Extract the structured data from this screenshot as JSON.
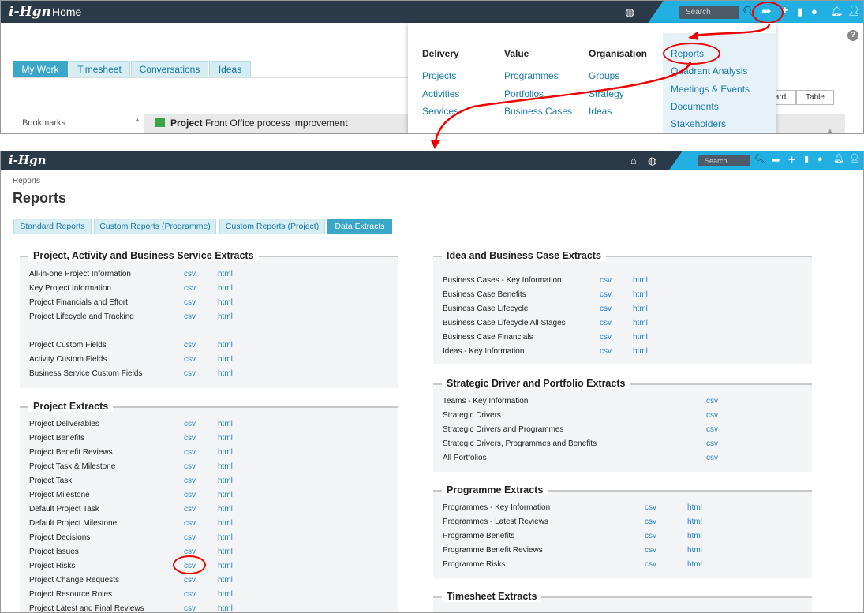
{
  "top": {
    "logo": "i-Hgn",
    "title": "Home",
    "search_placeholder": "Search",
    "tabs": [
      "My Work",
      "Timesheet",
      "Conversations",
      "Ideas"
    ],
    "bookmarks": "Bookmarks",
    "project_prefix": "Project",
    "project_name": " Front Office process improvement",
    "view_buttons": [
      "ard",
      "Table"
    ],
    "dropdown": {
      "columns": [
        {
          "heading": "Delivery",
          "items": [
            "Projects",
            "Activities",
            "Services"
          ]
        },
        {
          "heading": "Value",
          "items": [
            "Programmes",
            "Portfolios",
            "Business Cases"
          ]
        },
        {
          "heading": "Organisation",
          "items": [
            "Groups",
            "Strategy",
            "Ideas"
          ]
        },
        {
          "heading": "",
          "items": [
            "Reports",
            "Quadrant Analysis",
            "Meetings & Events",
            "Documents",
            "Stakeholders"
          ]
        }
      ]
    }
  },
  "bottom": {
    "logo": "i-Hgn",
    "search_placeholder": "Search",
    "breadcrumb": "Reports",
    "page_title": "Reports",
    "tabs": [
      "Standard Reports",
      "Custom Reports (Programme)",
      "Custom Reports (Project)",
      "Data Extracts"
    ],
    "active_tab": "Data Extracts",
    "left_sections": [
      {
        "title": "Project, Activity and Business Service Extracts",
        "rows": [
          {
            "label": "All-in-one Project Information",
            "csv": "csv",
            "html": "html"
          },
          {
            "label": "Key Project Information",
            "csv": "csv",
            "html": "html"
          },
          {
            "label": "Project Financials and Effort",
            "csv": "csv",
            "html": "html"
          },
          {
            "label": "Project Lifecycle and Tracking",
            "csv": "csv",
            "html": "html"
          },
          {
            "label": "",
            "csv": "",
            "html": ""
          },
          {
            "label": "Project Custom Fields",
            "csv": "csv",
            "html": "html"
          },
          {
            "label": "Activity Custom Fields",
            "csv": "csv",
            "html": "html"
          },
          {
            "label": "Business Service Custom Fields",
            "csv": "csv",
            "html": "html"
          }
        ]
      },
      {
        "title": "Project Extracts",
        "rows": [
          {
            "label": "Project Deliverables",
            "csv": "csv",
            "html": "html"
          },
          {
            "label": "Project Benefits",
            "csv": "csv",
            "html": "html"
          },
          {
            "label": "Project Benefit Reviews",
            "csv": "csv",
            "html": "html"
          },
          {
            "label": "Project Task & Milestone",
            "csv": "csv",
            "html": "html"
          },
          {
            "label": "Project Task",
            "csv": "csv",
            "html": "html"
          },
          {
            "label": "Project Milestone",
            "csv": "csv",
            "html": "html"
          },
          {
            "label": "Default Project Task",
            "csv": "csv",
            "html": "html"
          },
          {
            "label": "Default Project Milestone",
            "csv": "csv",
            "html": "html"
          },
          {
            "label": "Project Decisions",
            "csv": "csv",
            "html": "html"
          },
          {
            "label": "Project Issues",
            "csv": "csv",
            "html": "html"
          },
          {
            "label": "Project Risks",
            "csv": "csv",
            "html": "html"
          },
          {
            "label": "Project Change Requests",
            "csv": "csv",
            "html": "html"
          },
          {
            "label": "Project Resource Roles",
            "csv": "csv",
            "html": "html"
          },
          {
            "label": "Project Latest and Final Reviews",
            "csv": "csv",
            "html": "html"
          }
        ]
      }
    ],
    "right_sections": [
      {
        "title": "Idea and Business Case Extracts",
        "rows": [
          {
            "label": "Business Cases - Key Information",
            "csv": "csv",
            "html": "html"
          },
          {
            "label": "Business Case Benefits",
            "csv": "csv",
            "html": "html"
          },
          {
            "label": "Business Case Lifecycle",
            "csv": "csv",
            "html": "html"
          },
          {
            "label": "Business Case Lifecycle All Stages",
            "csv": "csv",
            "html": "html"
          },
          {
            "label": "Business Case Financials",
            "csv": "csv",
            "html": "html"
          },
          {
            "label": "Ideas - Key Information",
            "csv": "csv",
            "html": "html"
          }
        ]
      },
      {
        "title": "Strategic Driver and Portfolio Extracts",
        "rows": [
          {
            "label": "Teams - Key Information",
            "csv": "csv",
            "html": ""
          },
          {
            "label": "Strategic Drivers",
            "csv": "csv",
            "html": ""
          },
          {
            "label": "Strategic Drivers and Programmes",
            "csv": "csv",
            "html": ""
          },
          {
            "label": "Strategic Drivers, Programmes and Benefits",
            "csv": "csv",
            "html": ""
          },
          {
            "label": "All Portfolios",
            "csv": "csv",
            "html": ""
          }
        ]
      },
      {
        "title": "Programme Extracts",
        "rows": [
          {
            "label": "Programmes - Key Information",
            "csv": "csv",
            "html": "html"
          },
          {
            "label": "Programmes - Latest Reviews",
            "csv": "csv",
            "html": "html"
          },
          {
            "label": "Programme Benefits",
            "csv": "csv",
            "html": "html"
          },
          {
            "label": "Programme Benefit Reviews",
            "csv": "csv",
            "html": "html"
          },
          {
            "label": "Programme Risks",
            "csv": "csv",
            "html": "html"
          }
        ]
      },
      {
        "title": "Timesheet Extracts",
        "rows": []
      }
    ]
  },
  "colors": {
    "topbar": "#2b3a48",
    "accent": "#22b0e2",
    "link": "#1a7ab0",
    "highlight": "#e00000"
  },
  "icons": [
    "globe-icon",
    "search-icon",
    "share-icon",
    "plus-icon",
    "bookmark-icon",
    "chat-icon",
    "bell-icon",
    "user-icon",
    "home-icon",
    "help-icon"
  ]
}
